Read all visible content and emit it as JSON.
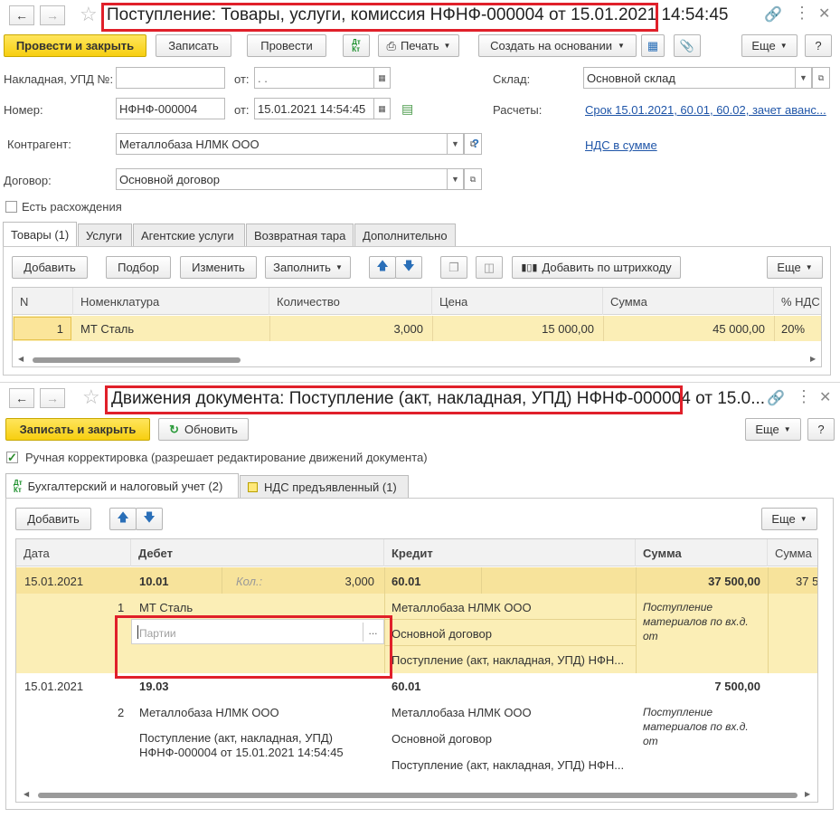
{
  "win1": {
    "title": "Поступление: Товары, услуги, комиссия НФНФ-000004 от 15.01.2021 14:54:45",
    "toolbar": {
      "post_close": "Провести и закрыть",
      "save": "Записать",
      "post": "Провести",
      "dtkt": "Дт Кт",
      "print": "Печать",
      "create_based": "Создать на основании",
      "more": "Еще",
      "help": "?"
    },
    "fields": {
      "invoice_label": "Накладная, УПД №:",
      "invoice_value": "",
      "from_label": "от:",
      "invoice_date": " .  .",
      "number_label": "Номер:",
      "number_value": "НФНФ-000004",
      "number_from_label": "от:",
      "number_date": "15.01.2021 14:54:45",
      "warehouse_label": "Склад:",
      "warehouse_value": "Основной склад",
      "settlements_label": "Расчеты:",
      "settlements_link": "Срок 15.01.2021, 60.01, 60.02, зачет аванс...",
      "counterparty_label": "Контрагент:",
      "counterparty_value": "Металлобаза НЛМК ООО",
      "help_q": "?",
      "vat_link": "НДС в сумме",
      "contract_label": "Договор:",
      "contract_value": "Основной договор",
      "discrepancy_label": "Есть расхождения"
    },
    "tabs": [
      "Товары (1)",
      "Услуги",
      "Агентские услуги",
      "Возвратная тара",
      "Дополнительно"
    ],
    "table_toolbar": {
      "add": "Добавить",
      "pick": "Подбор",
      "change": "Изменить",
      "fill": "Заполнить",
      "barcode": "Добавить по штрихкоду",
      "more": "Еще"
    },
    "columns": [
      "N",
      "Номенклатура",
      "Количество",
      "Цена",
      "Сумма",
      "% НДС"
    ],
    "rows": [
      {
        "n": "1",
        "item": "МТ Сталь",
        "qty": "3,000",
        "price": "15 000,00",
        "sum": "45 000,00",
        "vat": "20%"
      }
    ]
  },
  "win2": {
    "title_highlight": "Движения документа: Поступление (акт, накладная, УПД) НФНФ-000004",
    "title_rest": "от 15.0...",
    "toolbar": {
      "save_close": "Записать и закрыть",
      "refresh": "Обновить",
      "more": "Еще",
      "help": "?"
    },
    "manual_label": "Ручная корректировка (разрешает редактирование движений документа)",
    "tabs": [
      "Бухгалтерский и налоговый учет (2)",
      "НДС предъявленный (1)"
    ],
    "table_toolbar": {
      "add": "Добавить",
      "more": "Еще"
    },
    "columns": [
      "Дата",
      "Дебет",
      "Кредит",
      "Сумма",
      "Сумма"
    ],
    "entries": [
      {
        "date": "15.01.2021",
        "n": "1",
        "debit_account": "10.01",
        "qty_label": "Кол.:",
        "qty": "3,000",
        "debit_sub1": "МТ Сталь",
        "debit_sub2_placeholder": "Партии",
        "credit_account": "60.01",
        "credit_sub1": "Металлобаза НЛМК ООО",
        "credit_sub2": "Основной договор",
        "credit_sub3": "Поступление (акт, накладная, УПД) НФН...",
        "sum": "37 500,00",
        "sum2": "37 5",
        "content": "Поступление материалов по вх.д. от"
      },
      {
        "date": "15.01.2021",
        "n": "2",
        "debit_account": "19.03",
        "debit_sub1": "Металлобаза НЛМК ООО",
        "debit_sub2": "Поступление (акт, накладная, УПД) НФНФ-000004 от 15.01.2021 14:54:45",
        "credit_account": "60.01",
        "credit_sub1": "Металлобаза НЛМК ООО",
        "credit_sub2": "Основной договор",
        "credit_sub3": "Поступление (акт, накладная, УПД) НФН...",
        "sum": "7 500,00",
        "content": "Поступление материалов по вх.д. от"
      }
    ]
  }
}
